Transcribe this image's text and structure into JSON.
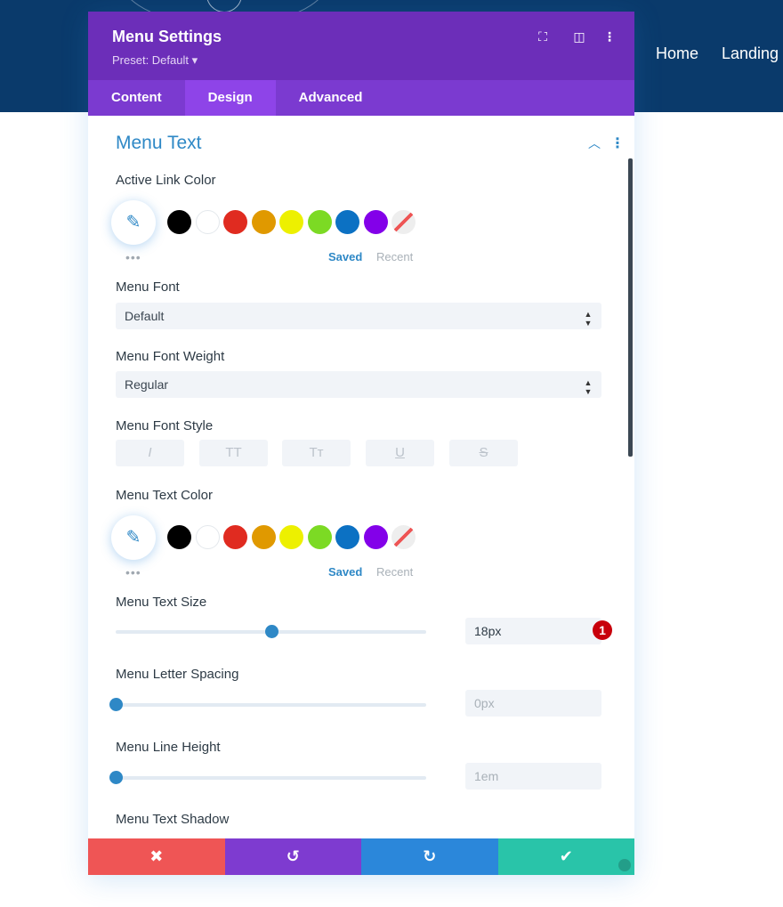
{
  "site_nav": {
    "items": [
      "Home",
      "Landing"
    ]
  },
  "panel": {
    "title": "Menu Settings",
    "preset": "Preset: Default ▾",
    "header_icons": [
      "fullscreen-icon",
      "split-view-icon",
      "more-icon"
    ],
    "tabs": [
      {
        "label": "Content"
      },
      {
        "label": "Design",
        "active": true
      },
      {
        "label": "Advanced"
      }
    ],
    "section": {
      "title": "Menu Text"
    },
    "swatch_colors": [
      "#000000",
      "#ffffff",
      "#e02b20",
      "#e09900",
      "#edf000",
      "#7cda24",
      "#0c71c3",
      "#8300e9"
    ],
    "active_link_color": {
      "label": "Active Link Color",
      "saved": "Saved",
      "recent": "Recent",
      "dots": "•••"
    },
    "menu_font": {
      "label": "Menu Font",
      "value": "Default",
      "arrow": "▲▼"
    },
    "menu_font_weight": {
      "label": "Menu Font Weight",
      "value": "Regular",
      "arrow": "▲▼"
    },
    "menu_font_style": {
      "label": "Menu Font Style",
      "buttons": [
        "I",
        "TT",
        "Tт",
        "U",
        "S"
      ]
    },
    "menu_text_color": {
      "label": "Menu Text Color",
      "saved": "Saved",
      "recent": "Recent",
      "dots": "•••"
    },
    "menu_text_size": {
      "label": "Menu Text Size",
      "value": "18px",
      "slider_percent": 50,
      "badge": "1"
    },
    "menu_letter_spacing": {
      "label": "Menu Letter Spacing",
      "value": "0px",
      "slider_percent": 0
    },
    "menu_line_height": {
      "label": "Menu Line Height",
      "value": "1em",
      "slider_percent": 0
    },
    "menu_text_shadow": {
      "label": "Menu Text Shadow"
    },
    "footer": {
      "cancel": "✖",
      "undo": "↺",
      "redo": "↻",
      "save": "✔"
    }
  }
}
